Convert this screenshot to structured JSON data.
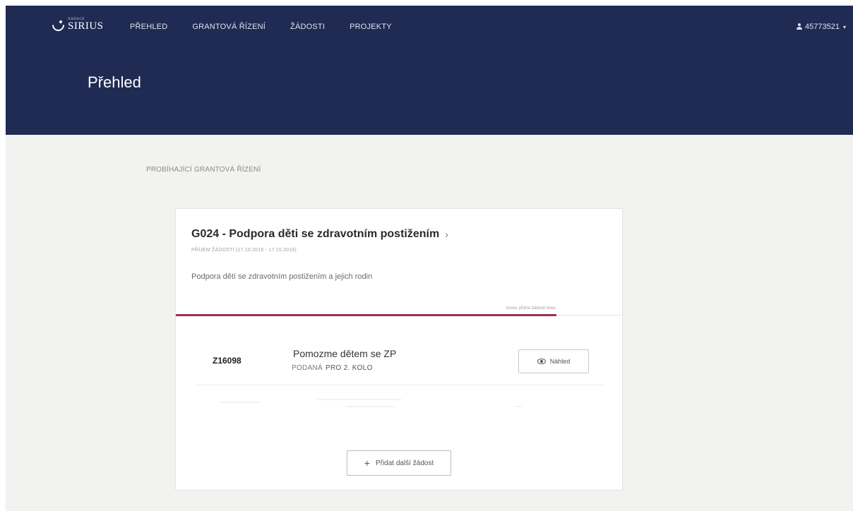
{
  "app": {
    "logo_small": "NADACE",
    "logo_big": "SIRIUS"
  },
  "nav": {
    "items": [
      {
        "label": "PŘEHLED"
      },
      {
        "label": "GRANTOVÁ ŘÍZENÍ"
      },
      {
        "label": "ŽÁDOSTI"
      },
      {
        "label": "PROJEKTY"
      }
    ]
  },
  "user": {
    "id": "45773521",
    "icon": "user-icon"
  },
  "page": {
    "title": "Přehled"
  },
  "section": {
    "label": "PROBÍHAJÍCÍ GRANTOVÁ ŘÍZENÍ"
  },
  "grant": {
    "title": "G024 - Podpora děti se zdravotním postižením",
    "subtitle": "PŘÍJEM ŽÁDOSTÍ (17.10.2016 - 17.10.2016)",
    "description": "Podpora dětí se zdravotním postižením a jejich rodin",
    "deadline_note": "konec příjmu žádostí dnes",
    "progress_fraction": 0.85,
    "accent_color": "#9c2c5a"
  },
  "application": {
    "id": "Z16098",
    "name": "Pomozme dětem se ZP",
    "status": "PODANÁ",
    "status_detail": "PRO 2. KOLO",
    "preview_label": "Náhled"
  },
  "actions": {
    "add_label": "Přidat další žádost"
  },
  "colors": {
    "header_bg": "#1f2b53",
    "page_bg": "#f2f2f0"
  }
}
